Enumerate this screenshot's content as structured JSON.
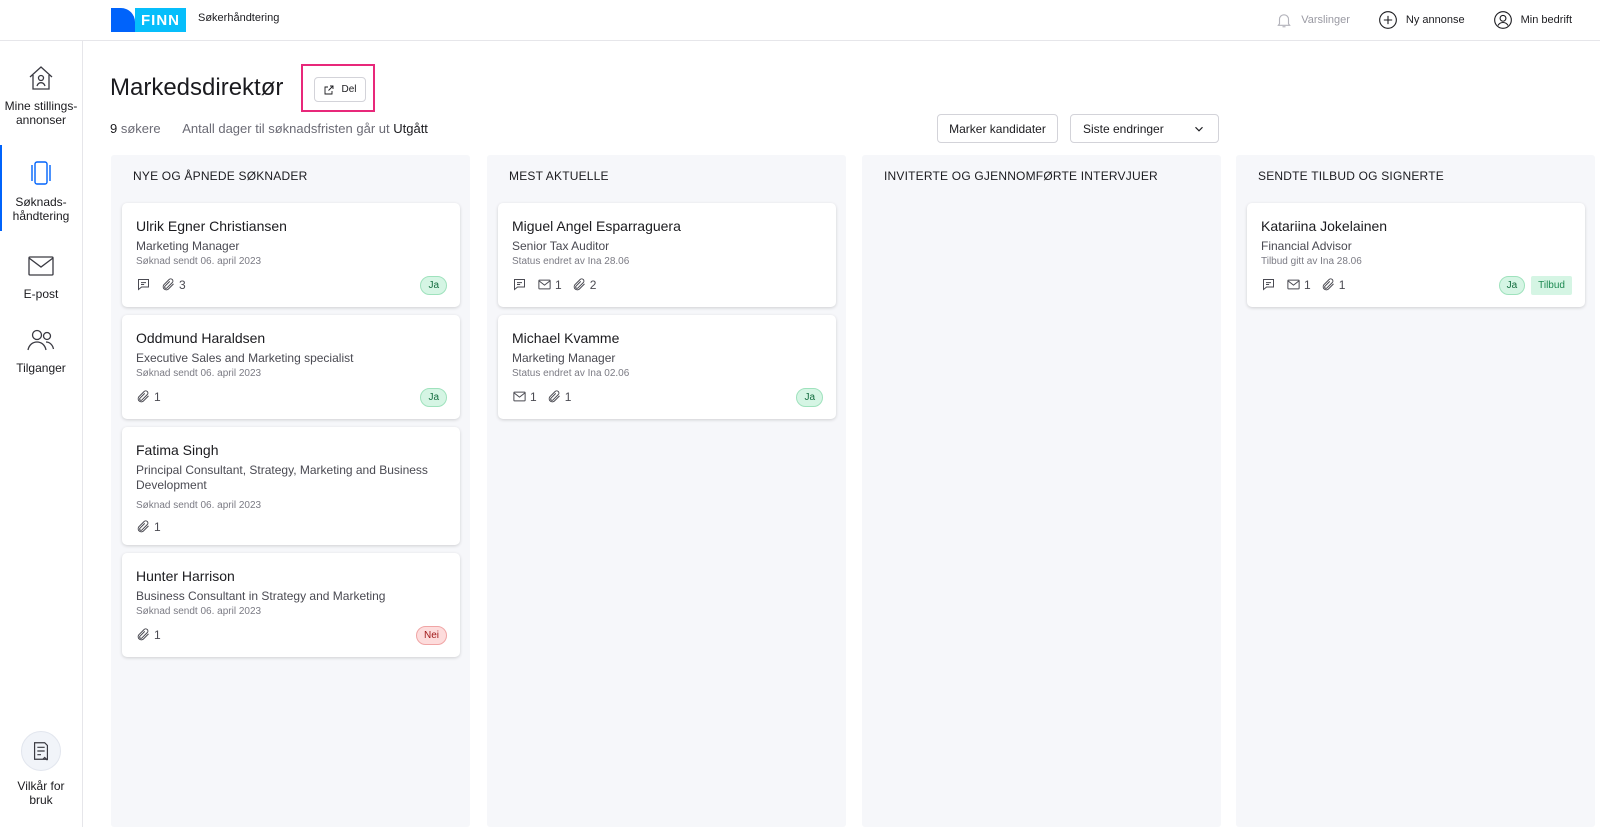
{
  "colors": {
    "accent": "#0063fb",
    "highlight": "#e8287a",
    "logo_box": "#06befb"
  },
  "header": {
    "logo_text": "FINN",
    "brand_sub": "Søkerhåndtering",
    "actions": [
      {
        "label": "Varslinger",
        "icon": "bell-icon"
      },
      {
        "label": "Ny annonse",
        "icon": "plus-circle-icon"
      },
      {
        "label": "Min bedrift",
        "icon": "user-circle-icon"
      }
    ]
  },
  "sidebar": {
    "items": [
      {
        "label1": "Mine stillings-",
        "label2": "annonser",
        "icon": "home-person-icon"
      },
      {
        "label1": "Søknads-",
        "label2": "håndtering",
        "icon": "cards-icon",
        "active": true
      },
      {
        "label1": "E-post",
        "icon": "envelope-icon"
      },
      {
        "label1": "Tilganger",
        "icon": "users-icon"
      }
    ],
    "bottom": {
      "label1": "Vilkår for",
      "label2": "bruk",
      "icon": "terms-icon"
    }
  },
  "main": {
    "title": "Markedsdirektør",
    "share_label": "Del",
    "applicant_count": "9",
    "applicant_word": "søkere",
    "deadline_text": "Antall dager til søknadsfristen går ut",
    "deadline_value": "Utgått",
    "mark_button": "Marker kandidater",
    "sort_value": "Siste endringer"
  },
  "columns": [
    {
      "title": "NYE OG ÅPNEDE SØKNADER",
      "cards": [
        {
          "name": "Ulrik Egner Christiansen",
          "role": "Marketing Manager",
          "date": "Søknad sendt 06. april 2023",
          "comments": true,
          "attachments": "3",
          "badges": [
            "Ja"
          ]
        },
        {
          "name": "Oddmund Haraldsen",
          "role": "Executive Sales and Marketing specialist",
          "date": "Søknad sendt 06. april 2023",
          "attachments": "1",
          "badges": [
            "Ja"
          ]
        },
        {
          "name": "Fatima Singh",
          "role": "Principal Consultant, Strategy, Marketing and Business Development",
          "date": "Søknad sendt 06. april 2023",
          "attachments": "1",
          "badges": []
        },
        {
          "name": "Hunter Harrison",
          "role": "Business Consultant in Strategy and Marketing",
          "date": "Søknad sendt 06. april 2023",
          "attachments": "1",
          "badges": [
            "Nei"
          ]
        }
      ]
    },
    {
      "title": "MEST AKTUELLE",
      "cards": [
        {
          "name": "Miguel Angel Esparraguera",
          "role": "Senior Tax Auditor",
          "date": "Status endret av Ina 28.06",
          "comments": true,
          "emails": "1",
          "attachments": "2",
          "badges": []
        },
        {
          "name": "Michael Kvamme",
          "role": "Marketing Manager",
          "date": "Status endret av Ina 02.06",
          "emails": "1",
          "attachments": "1",
          "badges": [
            "Ja"
          ]
        }
      ]
    },
    {
      "title": "INVITERTE OG GJENNOMFØRTE INTERVJUER",
      "cards": []
    },
    {
      "title": "SENDTE TILBUD OG SIGNERTE",
      "cards": [
        {
          "name": "Katariina Jokelainen",
          "role": "Financial Advisor",
          "date": "Tilbud gitt av Ina 28.06",
          "comments": true,
          "emails": "1",
          "attachments": "1",
          "badges": [
            "Ja",
            "Tilbud"
          ]
        }
      ]
    }
  ]
}
